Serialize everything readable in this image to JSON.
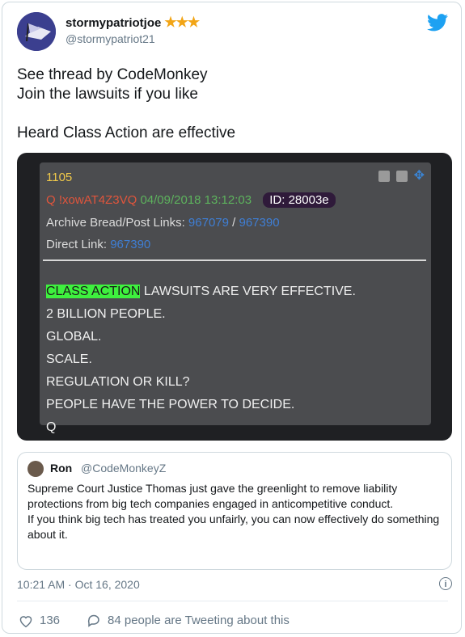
{
  "tweet": {
    "display_name": "stormypatriotjoe",
    "stars": "★★★",
    "handle": "@stormypatriot21",
    "text": "See thread by CodeMonkey\nJoin the lawsuits if you like\n\nHeard Class Action are effective",
    "timestamp": "10:21 AM · Oct 16, 2020",
    "like_count": "136",
    "conversation_text": "84 people are Tweeting about this"
  },
  "q_post": {
    "post_number": "1105",
    "q_name": "Q",
    "tripcode": "!xowAT4Z3VQ",
    "date": "04/09/2018 13:12:03",
    "id_label": "ID: 28003e",
    "archive_label": "Archive Bread/Post Links:",
    "archive_link_1": "967079",
    "separator": "/",
    "archive_link_2": "967390",
    "direct_label": "Direct Link:",
    "direct_link": "967390",
    "highlight": "CLASS ACTION",
    "body_first_rest": " LAWSUITS ARE VERY EFFECTIVE.",
    "body_rest": "2 BILLION PEOPLE.\nGLOBAL.\nSCALE.\nREGULATION OR KILL?\nPEOPLE HAVE THE POWER TO DECIDE.\nQ"
  },
  "quoted": {
    "name": "Ron",
    "handle": "@CodeMonkeyZ",
    "text": "Supreme Court Justice Thomas just gave the greenlight to remove liability protections from big tech companies engaged in anticompetitive conduct.\nIf you think big tech has treated you unfairly, you can now effectively do something about it."
  },
  "colors": {
    "twitter_blue": "#1da1f2",
    "star": "#f2a516",
    "highlight": "#3ef13e",
    "link": "#3f7ed4"
  }
}
